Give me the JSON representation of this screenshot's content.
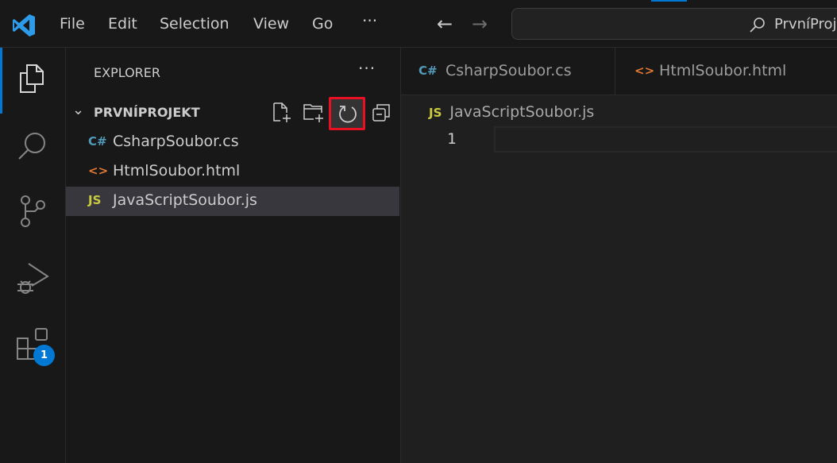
{
  "titlebar": {
    "menu": [
      "File",
      "Edit",
      "Selection",
      "View",
      "Go"
    ],
    "more": "···",
    "search_text": "PrvníProj"
  },
  "activity_bar": {
    "items": [
      "explorer-icon",
      "search-icon",
      "source-control-icon",
      "run-debug-icon",
      "extensions-icon"
    ],
    "extensions_badge": "1"
  },
  "sidebar": {
    "title": "EXPLORER",
    "more": "···",
    "project": "PRVNÍPROJEKT",
    "files": [
      {
        "name": "CsharpSoubor.cs",
        "icon": "C#",
        "color": "#519aba"
      },
      {
        "name": "HtmlSoubor.html",
        "icon": "<>",
        "color": "#e37933"
      },
      {
        "name": "JavaScriptSoubor.js",
        "icon": "JS",
        "color": "#cbcb41",
        "selected": true
      }
    ]
  },
  "editor": {
    "tabs": [
      {
        "name": "CsharpSoubor.cs",
        "icon": "C#"
      },
      {
        "name": "HtmlSoubor.html",
        "icon": "<>"
      }
    ],
    "breadcrumb": {
      "icon": "JS",
      "file": "JavaScriptSoubor.js"
    },
    "line_number": "1"
  },
  "colors": {
    "accent": "#0078d4",
    "highlight": "#e81123"
  }
}
